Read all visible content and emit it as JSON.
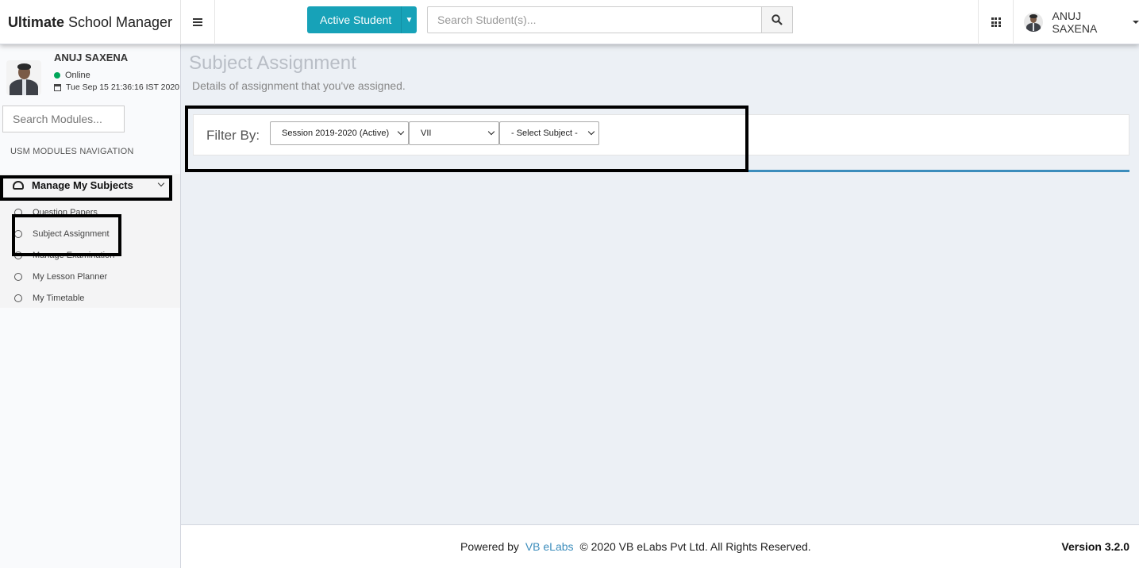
{
  "header": {
    "logo_bold": "Ultimate",
    "logo_rest": "School Manager",
    "student_btn": "Active Student",
    "search_placeholder": "Search Student(s)...",
    "user_name": "ANUJ SAXENA"
  },
  "sidebar": {
    "user_name": "ANUJ SAXENA",
    "status": "Online",
    "datetime": "Tue Sep 15 21:36:16 IST 2020",
    "search_placeholder": "Search Modules...",
    "nav_header": "USM MODULES NAVIGATION",
    "parent_label": "Manage My Subjects",
    "items": [
      {
        "label": "Question Papers"
      },
      {
        "label": "Subject Assignment"
      },
      {
        "label": "Manage Examination"
      },
      {
        "label": "My Lesson Planner"
      },
      {
        "label": "My Timetable"
      }
    ]
  },
  "main": {
    "title": "Subject Assignment",
    "subtitle": "Details of assignment that you've assigned.",
    "filter_label": "Filter By:",
    "session_select": "Session 2019-2020 (Active)",
    "class_select": "VII",
    "subject_select": "- Select Subject -"
  },
  "footer": {
    "powered_by": "Powered by",
    "link": "VB eLabs",
    "copyright": "© 2020 VB eLabs Pvt Ltd. All Rights Reserved.",
    "version": "Version 3.2.0"
  },
  "colors": {
    "accent": "#17a2b8",
    "link": "#3c8dbc",
    "online": "#00a65a",
    "background": "#ecf0f5"
  }
}
